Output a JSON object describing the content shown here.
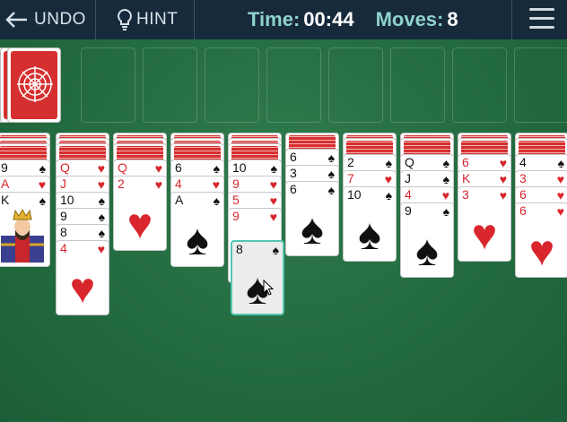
{
  "toolbar": {
    "undo_label": "UNDO",
    "hint_label": "HINT",
    "time_label": "Time:",
    "time_value": "00:44",
    "moves_label": "Moves:",
    "moves_value": "8"
  },
  "colors": {
    "red_suit": "#d8262c",
    "black_suit": "#111111",
    "felt": "#236b40",
    "card_back": "#d62f2f",
    "selection": "#55c7b3"
  },
  "stock": {
    "label": "stock-pile"
  },
  "foundation_slots": 8,
  "tableau": [
    {
      "face_down": 3,
      "cards": [
        {
          "rank": "9",
          "suit": "♠"
        },
        {
          "rank": "A",
          "suit": "♥"
        },
        {
          "rank": "K",
          "suit": "♠"
        }
      ]
    },
    {
      "face_down": 3,
      "cards": [
        {
          "rank": "Q",
          "suit": "♥"
        },
        {
          "rank": "J",
          "suit": "♥"
        },
        {
          "rank": "10",
          "suit": "♠"
        },
        {
          "rank": "9",
          "suit": "♠"
        },
        {
          "rank": "8",
          "suit": "♠"
        },
        {
          "rank": "4",
          "suit": "♥"
        }
      ]
    },
    {
      "face_down": 3,
      "cards": [
        {
          "rank": "Q",
          "suit": "♥"
        },
        {
          "rank": "2",
          "suit": "♥"
        }
      ]
    },
    {
      "face_down": 3,
      "cards": [
        {
          "rank": "6",
          "suit": "♠"
        },
        {
          "rank": "4",
          "suit": "♥"
        },
        {
          "rank": "A",
          "suit": "♠"
        }
      ]
    },
    {
      "face_down": 3,
      "cards": [
        {
          "rank": "10",
          "suit": "♠"
        },
        {
          "rank": "9",
          "suit": "♥"
        },
        {
          "rank": "5",
          "suit": "♥"
        },
        {
          "rank": "9",
          "suit": "♥"
        }
      ],
      "dragged": {
        "rank": "8",
        "suit": "♠"
      }
    },
    {
      "face_down": 1,
      "cards": [
        {
          "rank": "6",
          "suit": "♠"
        },
        {
          "rank": "3",
          "suit": "♠"
        },
        {
          "rank": "6",
          "suit": "♠"
        }
      ]
    },
    {
      "face_down": 2,
      "cards": [
        {
          "rank": "2",
          "suit": "♠"
        },
        {
          "rank": "7",
          "suit": "♥"
        },
        {
          "rank": "10",
          "suit": "♠"
        }
      ]
    },
    {
      "face_down": 2,
      "cards": [
        {
          "rank": "Q",
          "suit": "♠"
        },
        {
          "rank": "J",
          "suit": "♠"
        },
        {
          "rank": "4",
          "suit": "♥"
        },
        {
          "rank": "9",
          "suit": "♠"
        }
      ]
    },
    {
      "face_down": 2,
      "cards": [
        {
          "rank": "6",
          "suit": "♥"
        },
        {
          "rank": "K",
          "suit": "♥"
        },
        {
          "rank": "3",
          "suit": "♥"
        }
      ]
    },
    {
      "face_down": 2,
      "cards": [
        {
          "rank": "4",
          "suit": "♠"
        },
        {
          "rank": "3",
          "suit": "♥"
        },
        {
          "rank": "6",
          "suit": "♥"
        },
        {
          "rank": "6",
          "suit": "♥"
        }
      ]
    }
  ]
}
